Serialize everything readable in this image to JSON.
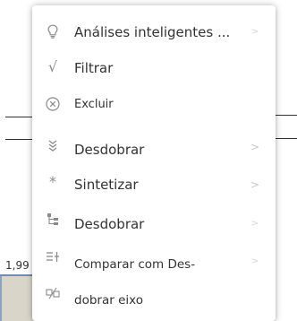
{
  "background": {
    "value_label": "1,99"
  },
  "menu": {
    "items": [
      {
        "label": "Análises inteligentes ...",
        "icon": "lightbulb-icon",
        "has_submenu": true
      },
      {
        "label": "Filtrar",
        "icon": "checkmark-icon",
        "has_submenu": false
      },
      {
        "label": "Excluir",
        "icon": "circle-x-icon",
        "has_submenu": false
      },
      {
        "label": "Desdobrar",
        "icon": "drill-down-chevrons-icon",
        "has_submenu": true
      },
      {
        "label": "Sintetizar",
        "icon": "asterisk-icon",
        "has_submenu": true
      },
      {
        "label": "Desdobrar",
        "icon": "hierarchy-icon",
        "has_submenu": true
      },
      {
        "label": "Comparar com Des-",
        "icon": "compare-icon",
        "has_submenu": true
      },
      {
        "label": "dobrar eixo",
        "icon": "swap-axis-icon",
        "has_submenu": false
      }
    ],
    "icons": {
      "filter_check": "√",
      "sintetizar_asterisk": "*",
      "chevron": ">"
    }
  },
  "colors": {
    "icon_gray": "#8a8a8a",
    "text": "#333333",
    "chevron": "#c6c6c6"
  }
}
